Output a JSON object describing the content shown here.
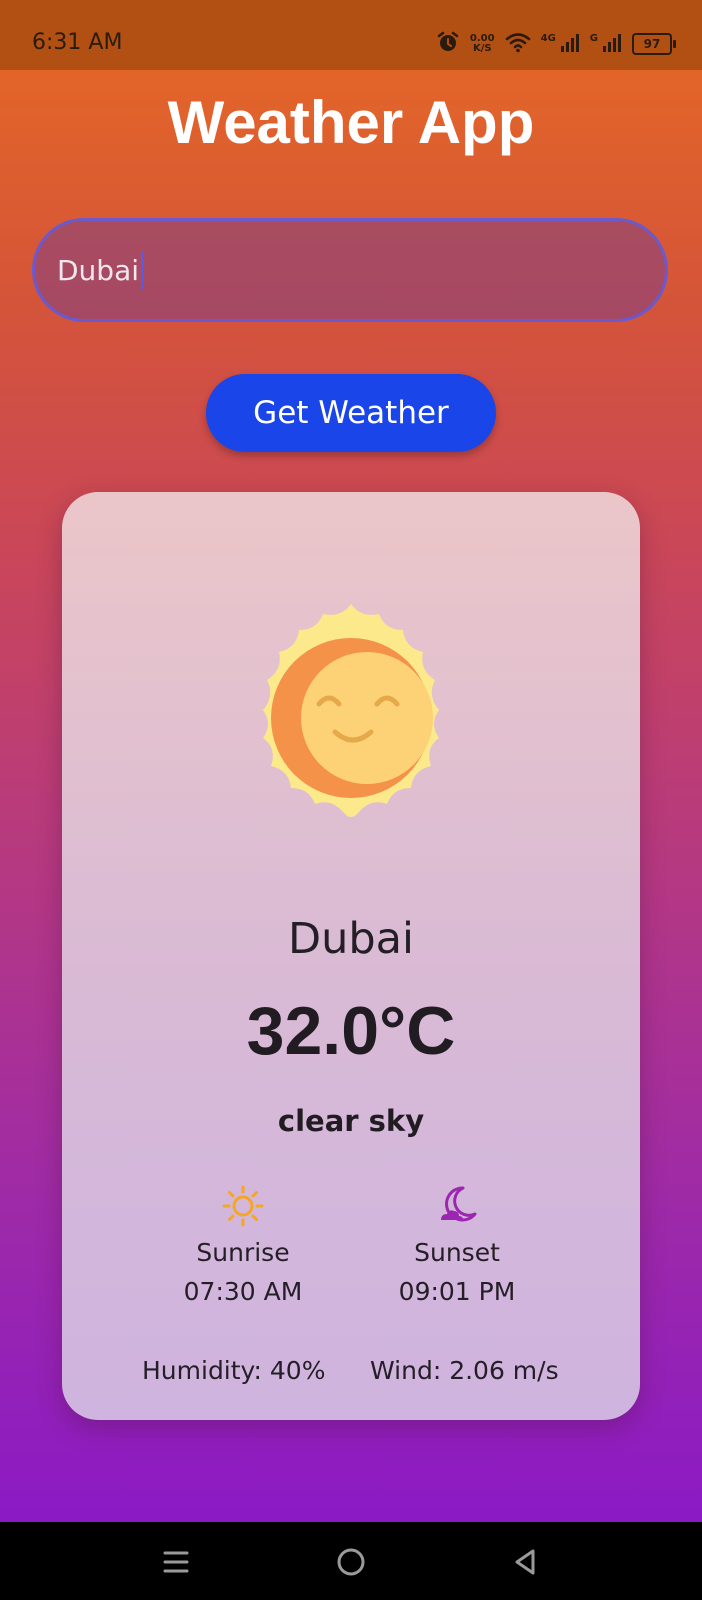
{
  "status_bar": {
    "time": "6:31 AM",
    "net_speed_value": "0.00",
    "net_speed_unit": "K/S",
    "network_4g": "4G",
    "network_g": "G",
    "battery_level": "97"
  },
  "header": {
    "title": "Weather App"
  },
  "search": {
    "value": "Dubai"
  },
  "actions": {
    "get_weather_label": "Get Weather"
  },
  "weather": {
    "icon": "smiling-sun",
    "city": "Dubai",
    "temperature": "32.0°C",
    "description": "clear sky",
    "sunrise_label": "Sunrise",
    "sunrise_time": "07:30 AM",
    "sunset_label": "Sunset",
    "sunset_time": "09:01 PM",
    "humidity": "Humidity: 40%",
    "wind": "Wind: 2.06 m/s"
  },
  "colors": {
    "gradient_top": "#E76A24",
    "gradient_bottom": "#8616CC",
    "button": "#1A45E8",
    "sunrise_icon": "#F5A623",
    "sunset_icon": "#9B27B0"
  },
  "nav": {
    "icons": [
      "menu-icon",
      "home-icon",
      "back-icon"
    ]
  }
}
